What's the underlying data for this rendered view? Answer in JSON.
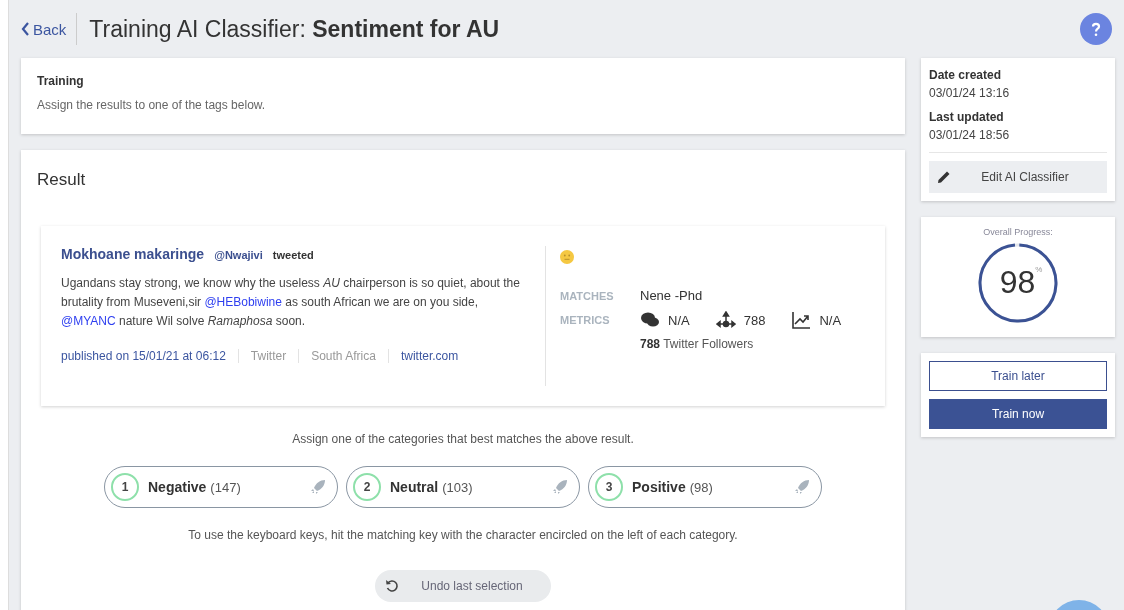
{
  "header": {
    "back": "Back",
    "title": "Training AI Classifier: **Sentiment for AU**"
  },
  "intro": {
    "title": "Training",
    "text": "Assign the results to one of the tags below."
  },
  "result": {
    "title": "Result",
    "post": {
      "author": "Mokhoane makaringe",
      "handle": "@Nwajivi",
      "action": "tweeted",
      "text": [
        {
          "kind": "plain",
          "text": "Ugandans stay strong, we know why the useless "
        },
        {
          "kind": "italic",
          "text": "AU"
        },
        {
          "kind": "plain",
          "text": " chairperson is so quiet, about the brutality from Museveni,sir "
        },
        {
          "kind": "mention",
          "text": "@HEBobiwine"
        },
        {
          "kind": "plain",
          "text": " as south African we are on you side, "
        },
        {
          "kind": "mention",
          "text": "@MYANC"
        },
        {
          "kind": "plain",
          "text": " nature Wil solve "
        },
        {
          "kind": "italic",
          "text": "Ramaphosa"
        },
        {
          "kind": "plain",
          "text": " soon."
        }
      ],
      "published": "published on 15/01/21 at 06:12",
      "source": "Twitter",
      "country": "South Africa",
      "domain": "twitter.com",
      "matches_label": "MATCHES",
      "matches": "Nene -Phd",
      "metrics_label": "METRICS",
      "metrics": [
        {
          "kind": "comments",
          "value": "N/A"
        },
        {
          "kind": "reach",
          "value": "788"
        },
        {
          "kind": "trend",
          "value": "N/A"
        }
      ],
      "followers_count": "788",
      "followers_label": "Twitter Followers"
    },
    "prompt": "Assign one of the categories that best matches the above result.",
    "categories": [
      {
        "key": "1",
        "name": "Negative",
        "count": "(147)"
      },
      {
        "key": "2",
        "name": "Neutral",
        "count": "(103)"
      },
      {
        "key": "3",
        "name": "Positive",
        "count": "(98)"
      }
    ],
    "hint": "To use the keyboard keys, hit the matching key with the character encircled on the left of each category.",
    "undo": "Undo last selection"
  },
  "info": {
    "created_label": "Date created",
    "created": "03/01/24 13:16",
    "updated_label": "Last updated",
    "updated": "03/01/24 18:56",
    "edit": "Edit AI Classifier"
  },
  "progress": {
    "label": "Overall Progress:",
    "value": "98",
    "unit": "%",
    "level": 0.98
  },
  "actions": {
    "later": "Train later",
    "now": "Train now"
  }
}
